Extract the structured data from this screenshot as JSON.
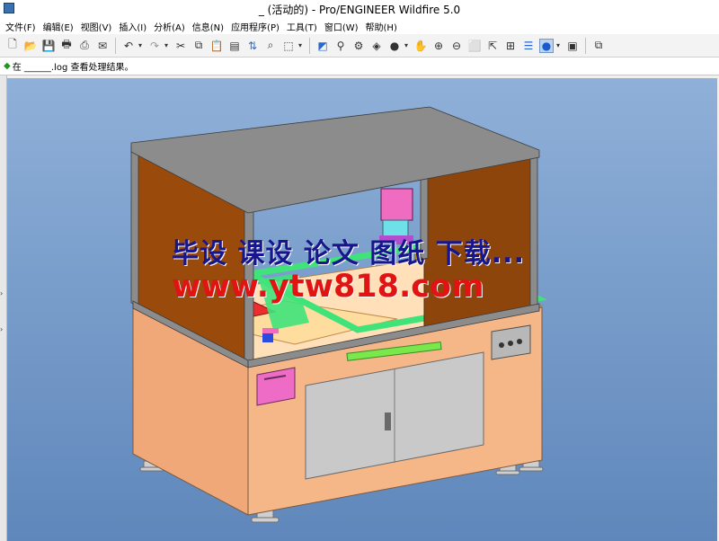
{
  "window": {
    "title": "_ (活动的) - Pro/ENGINEER Wildfire 5.0"
  },
  "menu": [
    "文件(F)",
    "编辑(E)",
    "视图(V)",
    "插入(I)",
    "分析(A)",
    "信息(N)",
    "应用程序(P)",
    "工具(T)",
    "窗口(W)",
    "帮助(H)"
  ],
  "message_area": {
    "text": "在 ______.log 查看处理结果。"
  },
  "viewport": {
    "model": "machine-enclosure-assembly",
    "watermark_line1": "毕设 课设 论文 图纸 下载...",
    "watermark_line2": "www.ytw818.com"
  },
  "colors": {
    "roof": "#e8720c",
    "side_panel": "#9a4a0a",
    "frame": "#8c8c8c",
    "base_cabinet": "#f4b07e",
    "door": "#c9c9c9",
    "bed": "#ffe0b8",
    "rail_green": "#40e37a",
    "bg_top": "#8fb0d8",
    "bg_bottom": "#5f87bb",
    "watermark_blue": "#17168c",
    "watermark_red": "#e11414"
  }
}
